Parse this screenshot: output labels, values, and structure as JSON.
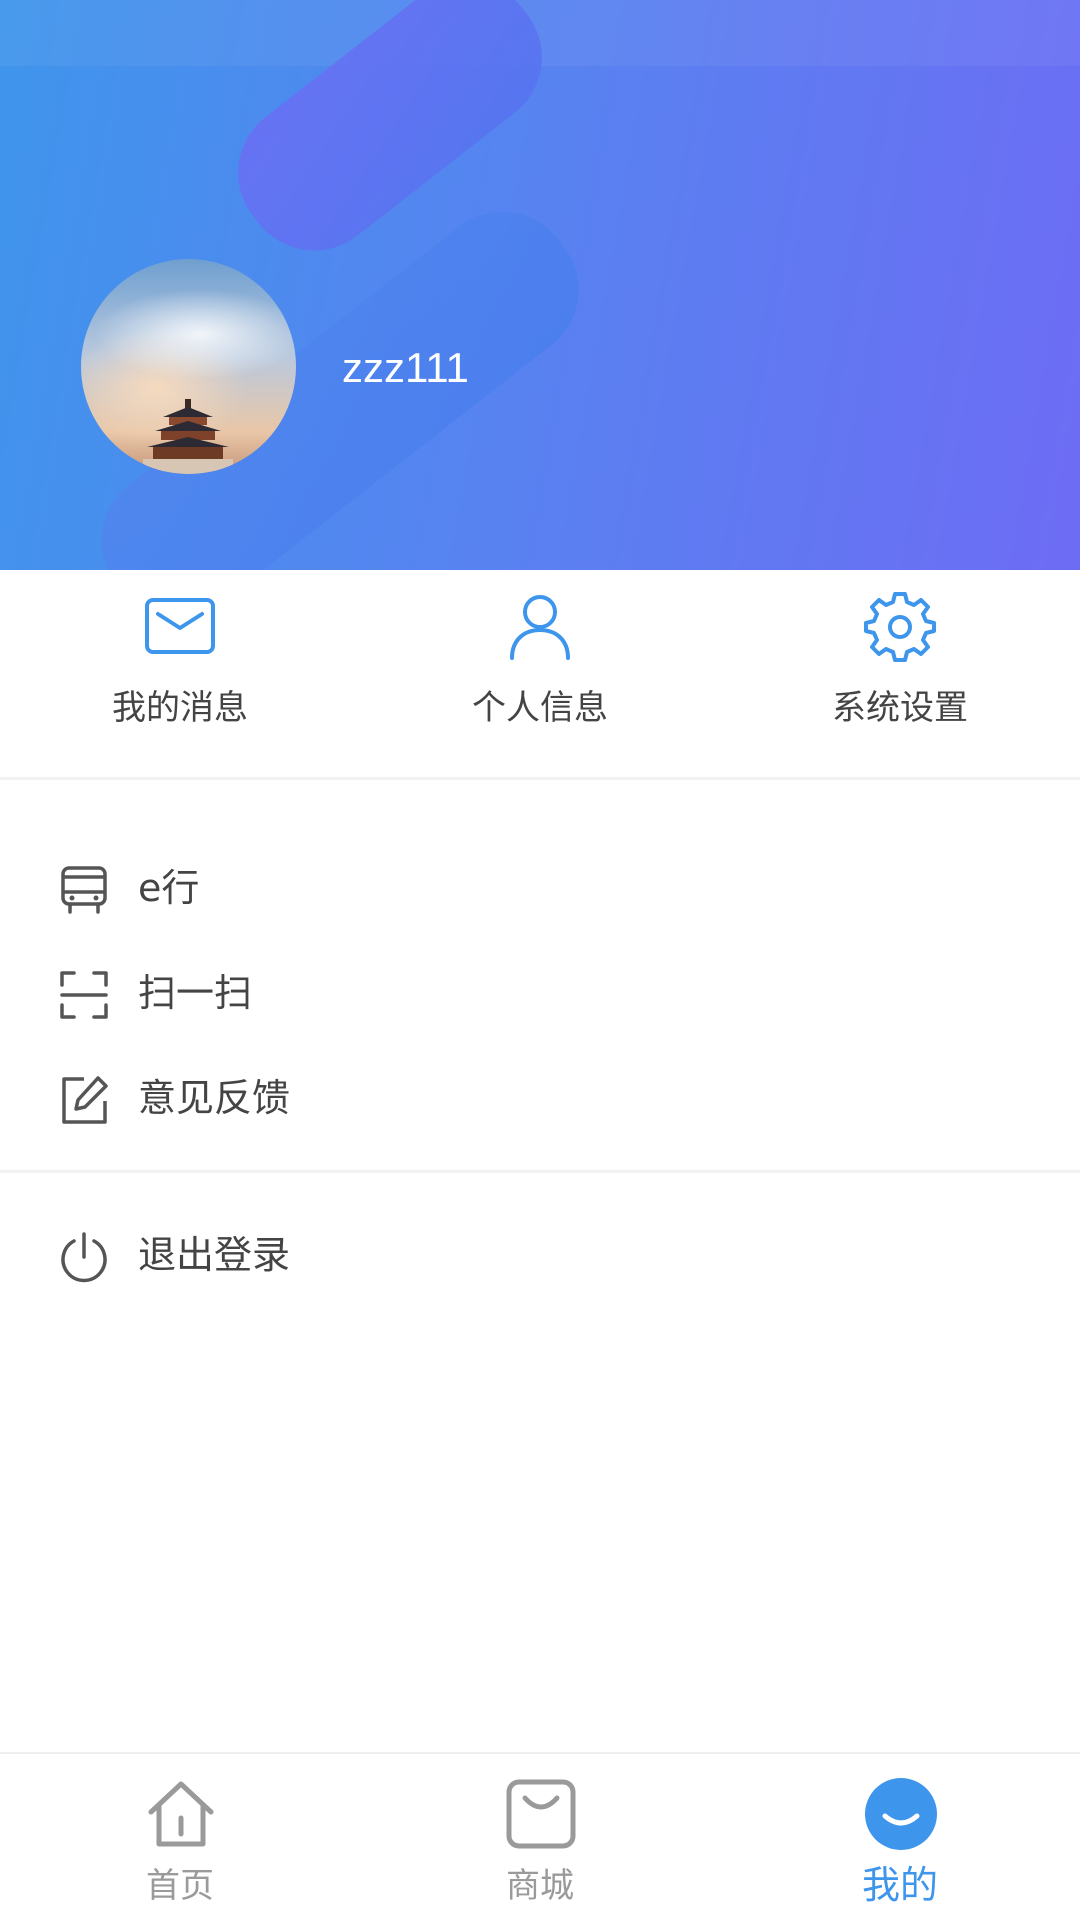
{
  "colors": {
    "accent": "#3d95ec",
    "header_gradient_start": "#3f95ec",
    "header_gradient_end": "#6d6cf4",
    "tab_inactive": "#9a9a9a",
    "text": "#444444"
  },
  "profile": {
    "username": "zzz111",
    "avatar_icon": "temple-of-heaven-photo"
  },
  "quick_actions": [
    {
      "label": "我的消息",
      "icon": "mail-icon"
    },
    {
      "label": "个人信息",
      "icon": "person-icon"
    },
    {
      "label": "系统设置",
      "icon": "gear-icon"
    }
  ],
  "menu": [
    {
      "label": "e行",
      "icon": "bus-icon"
    },
    {
      "label": "扫一扫",
      "icon": "scan-icon"
    },
    {
      "label": "意见反馈",
      "icon": "edit-icon"
    }
  ],
  "logout": {
    "label": "退出登录",
    "icon": "power-icon"
  },
  "tabbar": [
    {
      "label": "首页",
      "icon": "home-icon",
      "active": false
    },
    {
      "label": "商城",
      "icon": "shopping-bag-icon",
      "active": false
    },
    {
      "label": "我的",
      "icon": "smile-icon",
      "active": true
    }
  ]
}
